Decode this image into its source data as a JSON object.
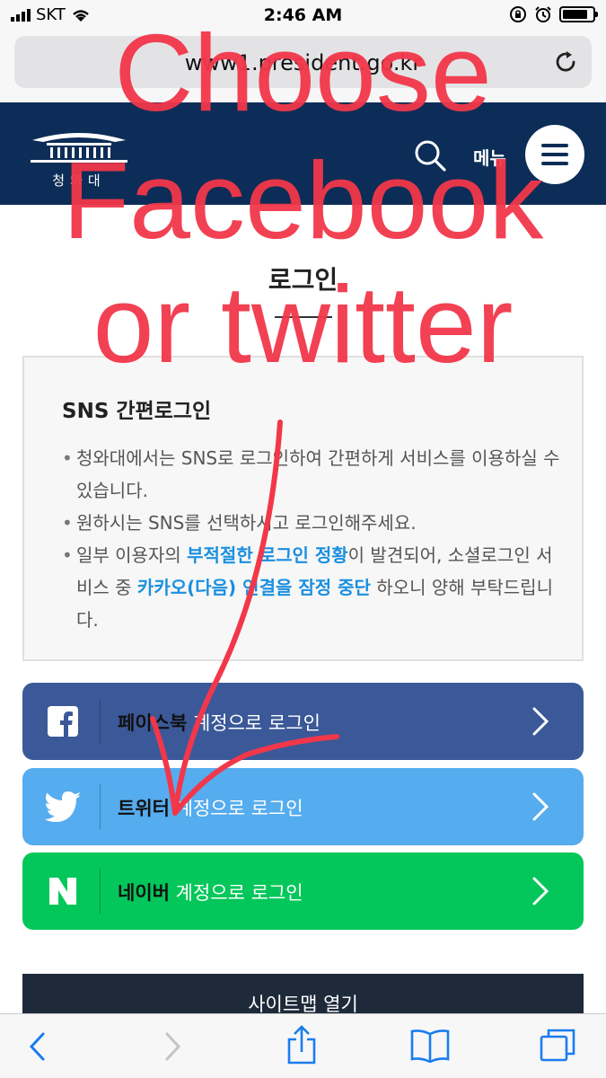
{
  "status_bar": {
    "carrier": "SKT",
    "time": "2:46 AM",
    "battery_level": 0.85
  },
  "browser": {
    "url": "www1.president.go.kr"
  },
  "header": {
    "logo_caption": "청와대",
    "menu_label": "메뉴"
  },
  "page": {
    "title": "로그인"
  },
  "info": {
    "heading": "SNS 간편로그인",
    "bullet1": "청와대에서는 SNS로 로그인하여 간편하게 서비스를 이용하실 수 있습니다.",
    "bullet2": "원하시는 SNS를 선택하시고 로그인해주세요.",
    "bullet3_a": "일부 이용자의 ",
    "bullet3_b": "부적절한 로그인 정황",
    "bullet3_c": "이 발견되어, 소셜로그인 서비스 중 ",
    "bullet3_d": "카카오(다음) 연결을 잠정 중단",
    "bullet3_e": "하오니 양해 부탁드립니다."
  },
  "logins": {
    "facebook_name": "페이스북",
    "twitter_name": "트위터",
    "naver_name": "네이버",
    "suffix": "계정으로 로그인",
    "facebook_color": "#3b5998",
    "twitter_color": "#55acee",
    "naver_color": "#03c75a"
  },
  "footer": {
    "sitemap": "사이트맵 열기"
  },
  "annotation": {
    "line1": "Choose",
    "line2": "Facebook",
    "line3": "or twitter",
    "color": "#f2374a"
  }
}
